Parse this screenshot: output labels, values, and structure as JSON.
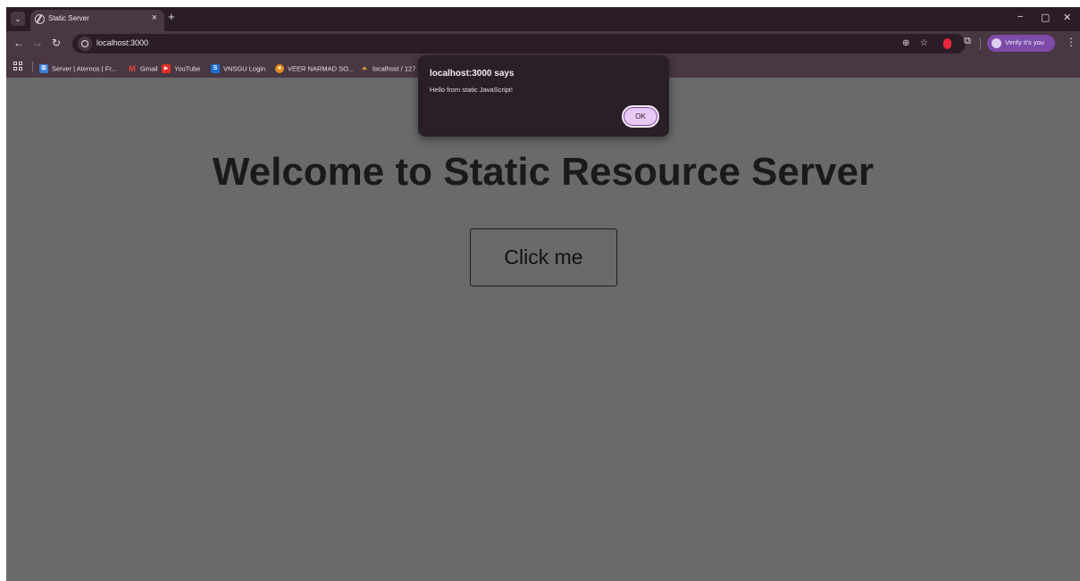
{
  "browser": {
    "tab": {
      "title": "Static Server",
      "close_glyph": "×"
    },
    "new_tab_glyph": "+",
    "window_controls": {
      "minimize": "−",
      "restore": "▢",
      "close": "✕"
    },
    "nav": {
      "back": "←",
      "forward": "→",
      "reload": "↻"
    },
    "address_bar": {
      "url": "localhost:3000"
    },
    "profile_chip": {
      "label": "Verify it's you"
    },
    "menu_glyph": "⋮",
    "bookmarks": [
      {
        "label": "Server | Aternos | Fr...",
        "icon": "aternos-icon",
        "color": "#3b7bd6"
      },
      {
        "label": "Gmail",
        "icon": "gmail-icon",
        "color": "#ea4335"
      },
      {
        "label": "YouTube",
        "icon": "youtube-icon",
        "color": "#e52d27"
      },
      {
        "label": "VNSGU Login",
        "icon": "vnsgu-icon",
        "color": "#1e6fd9"
      },
      {
        "label": "VEER NARMAD SO...",
        "icon": "veer-narmad-icon",
        "color": "#e38b1c"
      },
      {
        "label": "localhost / 127",
        "icon": "phpmyadmin-icon",
        "color": "#f0a830"
      }
    ]
  },
  "page": {
    "heading": "Welcome to Static Resource Server",
    "button_label": "Click me"
  },
  "alert": {
    "title": "localhost:3000 says",
    "message": "Hello from static JavaScript!",
    "ok_label": "OK"
  }
}
